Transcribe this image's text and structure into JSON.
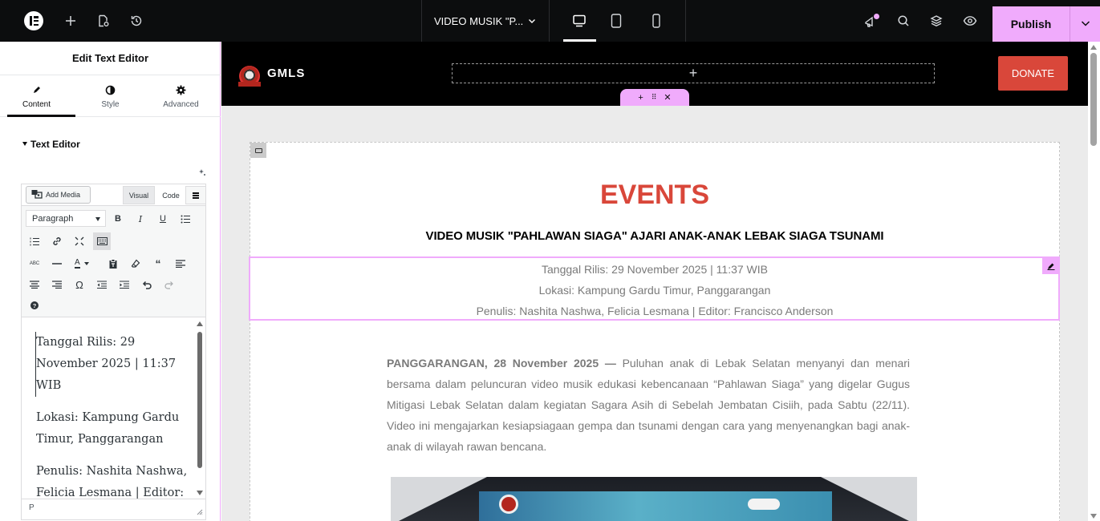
{
  "topbar": {
    "document_title": "VIDEO MUSIK \"P...",
    "publish_label": "Publish",
    "accent_color": "#f0abfc",
    "icons": [
      "elementor-logo-icon",
      "add-icon",
      "page-settings-icon",
      "history-icon",
      "chevron-down-icon",
      "desktop-icon",
      "tablet-icon",
      "mobile-icon",
      "announcements-icon",
      "search-icon",
      "structure-icon",
      "preview-icon"
    ]
  },
  "panel": {
    "title": "Edit Text Editor",
    "tabs": [
      {
        "label": "Content",
        "icon": "pencil-icon"
      },
      {
        "label": "Style",
        "icon": "contrast-icon"
      },
      {
        "label": "Advanced",
        "icon": "gear-icon"
      }
    ],
    "section_title": "Text Editor",
    "editor": {
      "add_media_label": "Add Media",
      "visual_tab": "Visual",
      "code_tab": "Code",
      "format_select": "Paragraph",
      "paragraphs": [
        "Tanggal Rilis: 29 November 2025 | 11:37 WIB",
        "Lokasi: Kampung Gardu Timur, Panggarangan",
        "Penulis: Nashita Nashwa, Felicia Lesmana | Editor: Francisco Anderson"
      ],
      "status_path": "P"
    }
  },
  "site": {
    "name": "GMLS",
    "donate_label": "DONATE",
    "brand_color": "#d9473a",
    "section_heading": "EVENTS",
    "article_title": "VIDEO MUSIK \"PAHLAWAN SIAGA\" AJARI ANAK-ANAK LEBAK SIAGA TSUNAMI",
    "meta": [
      "Tanggal Rilis: 29 November 2025 | 11:37 WIB",
      "Lokasi: Kampung Gardu Timur, Panggarangan",
      "Penulis: Nashita Nashwa, Felicia Lesmana | Editor: Francisco Anderson"
    ],
    "lead": "PANGGARANGAN, 28 November 2025 —",
    "body": " Puluhan anak di Lebak Selatan menyanyi dan menari bersama dalam peluncuran video musik edukasi kebencanaan “Pahlawan Siaga” yang digelar Gugus Mitigasi Lebak Selatan dalam kegiatan Sagara Asih di Sebelah Jembatan Cisiih, pada Sabtu (22/11). Video ini mengajarkan kesiapsiagaan gempa dan tsunami dengan cara yang menyenangkan bagi anak-anak di wilayah rawan bencana."
  }
}
